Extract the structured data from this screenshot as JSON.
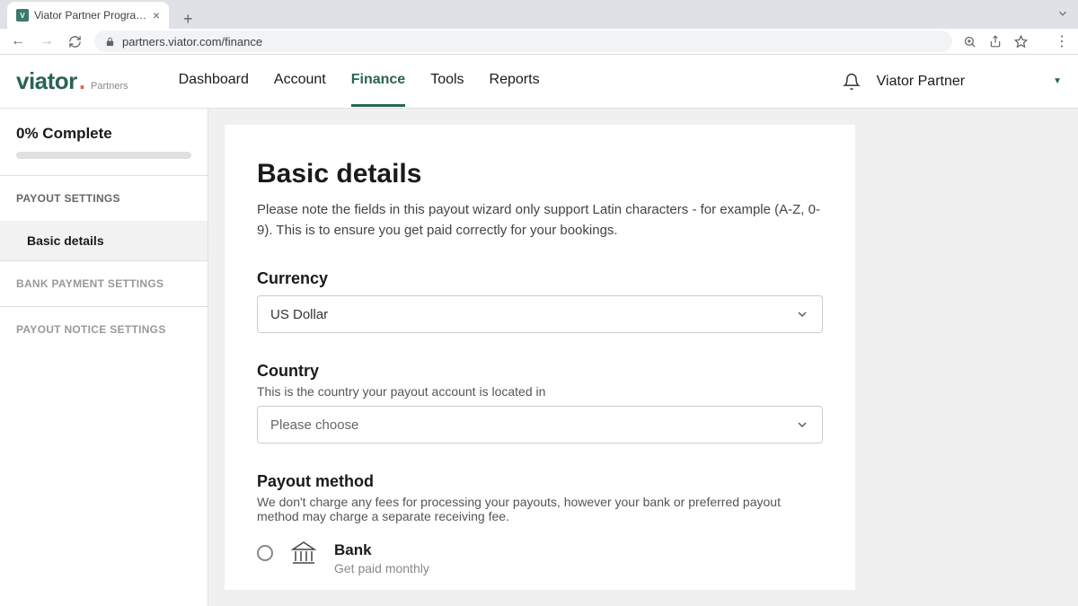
{
  "browser": {
    "tab_title": "Viator Partner Program - Finan",
    "url": "partners.viator.com/finance"
  },
  "header": {
    "logo_main": "viator",
    "logo_sub": "Partners",
    "nav": [
      {
        "label": "Dashboard"
      },
      {
        "label": "Account"
      },
      {
        "label": "Finance",
        "active": true
      },
      {
        "label": "Tools"
      },
      {
        "label": "Reports"
      }
    ],
    "user_name": "Viator Partner"
  },
  "sidebar": {
    "progress_label": "0% Complete",
    "sections": [
      {
        "title": "PAYOUT SETTINGS",
        "sub": "Basic details",
        "active": true
      },
      {
        "title": "BANK PAYMENT SETTINGS"
      },
      {
        "title": "PAYOUT NOTICE SETTINGS"
      }
    ]
  },
  "main": {
    "title": "Basic details",
    "description": "Please note the fields in this payout wizard only support Latin characters - for example (A-Z, 0-9). This is to ensure you get paid correctly for your bookings.",
    "currency": {
      "label": "Currency",
      "value": "US Dollar"
    },
    "country": {
      "label": "Country",
      "help": "This is the country your payout account is located in",
      "placeholder": "Please choose"
    },
    "payout_method": {
      "label": "Payout method",
      "help": "We don't charge any fees for processing your payouts, however your bank or preferred payout method may charge a separate receiving fee.",
      "option_title": "Bank",
      "option_sub": "Get paid monthly"
    }
  }
}
